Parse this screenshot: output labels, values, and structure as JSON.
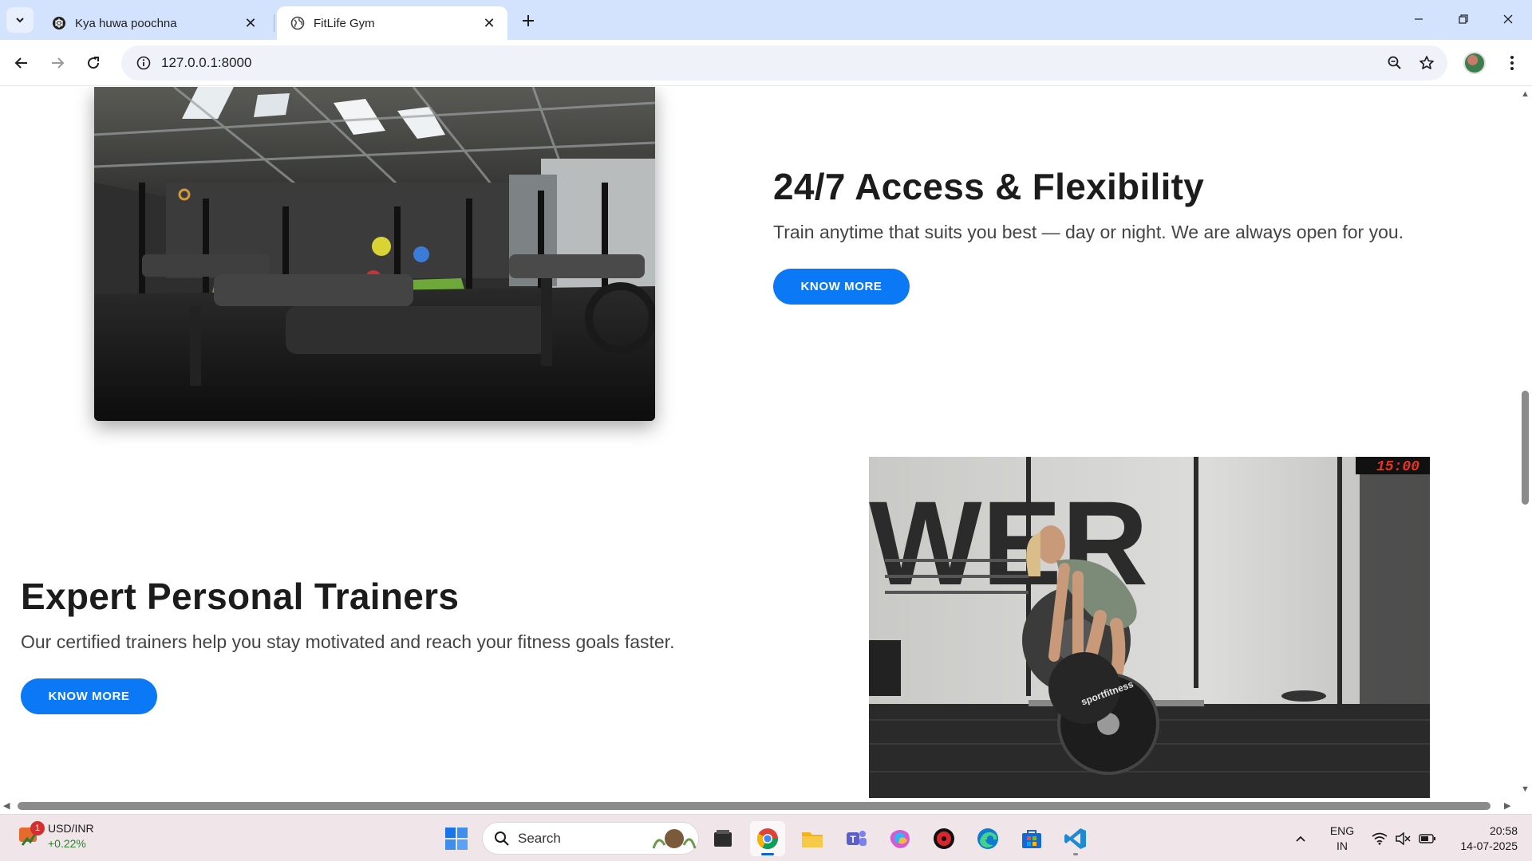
{
  "browser": {
    "tabs": [
      {
        "title": "Kya huwa poochna",
        "active": false,
        "favicon": "chatgpt-logo-icon"
      },
      {
        "title": "FitLife Gym",
        "active": true,
        "favicon": "globe-icon"
      }
    ],
    "url": "127.0.0.1:8000"
  },
  "page": {
    "features": [
      {
        "title": "24/7 Access & Flexibility",
        "description": "Train anytime that suits you best — day or night. We are always open for you.",
        "button": "KNOW MORE",
        "image": "gym-interior-photo"
      },
      {
        "title": "Expert Personal Trainers",
        "description": "Our certified trainers help you stay motivated and reach your fitness goals faster.",
        "button": "KNOW MORE",
        "image": "trainer-deadlift-photo",
        "image_texts": {
          "wall": "WER",
          "timer": "15:00",
          "plate": "sportfitness"
        }
      }
    ]
  },
  "taskbar": {
    "widget": {
      "title": "USD/INR",
      "change": "+0.22%",
      "badge": "1"
    },
    "search_placeholder": "Search",
    "apps": [
      "file-explorer-icon",
      "chrome-icon",
      "folder-icon",
      "teams-icon",
      "copilot-icon",
      "davinci-icon",
      "edge-icon",
      "store-icon",
      "vscode-icon"
    ],
    "language": {
      "line1": "ENG",
      "line2": "IN"
    },
    "time": "20:58",
    "date": "14-07-2025"
  },
  "colors": {
    "accent_button": "#0b78f5",
    "tabstrip": "#d3e3fd",
    "taskbar": "#f0e6ea"
  }
}
